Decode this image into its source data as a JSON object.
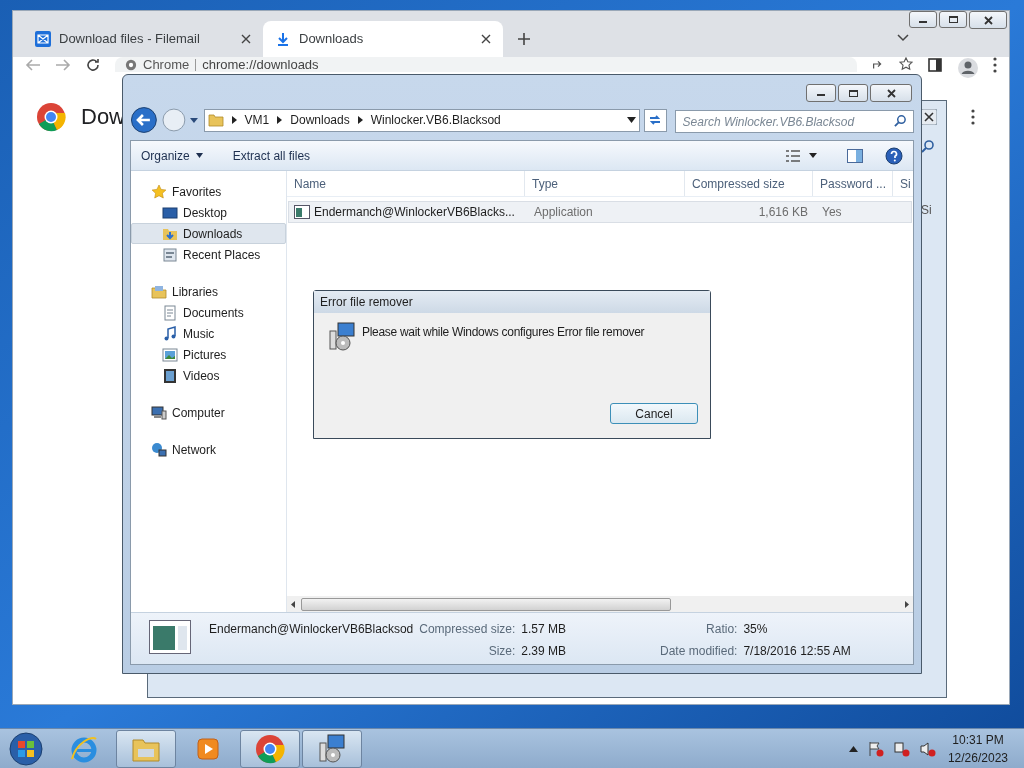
{
  "browser": {
    "tabs": [
      {
        "title": "Download files - Filemail",
        "kind": "filemail",
        "selected": false
      },
      {
        "title": "Downloads",
        "kind": "download",
        "selected": true
      }
    ],
    "address": {
      "label": "Chrome",
      "url": "chrome://downloads"
    },
    "heading": "Dow"
  },
  "back_window": {
    "column_label": "Si"
  },
  "explorer": {
    "breadcrumb": [
      "VM1",
      "Downloads",
      "Winlocker.VB6.Blacksod"
    ],
    "search": {
      "placeholder": "Search Winlocker.VB6.Blacksod"
    },
    "toolbar": [
      "Organize",
      "Extract all files"
    ],
    "nav": [
      {
        "label": "Favorites",
        "kind": "star",
        "selected": false,
        "children": [
          {
            "label": "Desktop",
            "kind": "desktop",
            "selected": false
          },
          {
            "label": "Downloads",
            "kind": "downloads",
            "selected": true
          },
          {
            "label": "Recent Places",
            "kind": "recent",
            "selected": false
          }
        ]
      },
      {
        "label": "Libraries",
        "kind": "library",
        "selected": false,
        "children": [
          {
            "label": "Documents",
            "kind": "documents",
            "selected": false
          },
          {
            "label": "Music",
            "kind": "music",
            "selected": false
          },
          {
            "label": "Pictures",
            "kind": "pictures",
            "selected": false
          },
          {
            "label": "Videos",
            "kind": "videos",
            "selected": false
          }
        ]
      },
      {
        "label": "Computer",
        "kind": "computer",
        "selected": false
      },
      {
        "label": "Network",
        "kind": "network",
        "selected": false
      }
    ],
    "columns": [
      "Name",
      "Type",
      "Compressed size",
      "Password ...",
      "Si"
    ],
    "rows": [
      {
        "name": "Endermanch@WinlockerVB6Blacks...",
        "type": "Application",
        "size": "1,616 KB",
        "password": "Yes",
        "selected": true
      }
    ],
    "details": {
      "name": "Endermanch@WinlockerVB6Blacksod",
      "fields": [
        {
          "label": "Compressed size:",
          "value": "1.57 MB"
        },
        {
          "label": "Ratio:",
          "value": "35%"
        },
        {
          "label": "Size:",
          "value": "2.39 MB"
        },
        {
          "label": "Date modified:",
          "value": "7/18/2016 12:55 AM"
        }
      ]
    }
  },
  "dialog": {
    "title": "Error file remover",
    "message": "Please wait while Windows configures Error file remover",
    "button": "Cancel"
  },
  "taskbar": {
    "items": [
      {
        "kind": "ie",
        "open": false
      },
      {
        "kind": "explorer",
        "open": true
      },
      {
        "kind": "media",
        "open": false
      },
      {
        "kind": "chrome",
        "open": true
      },
      {
        "kind": "installer",
        "open": true
      }
    ],
    "time": "10:31 PM",
    "date": "12/26/2023"
  }
}
